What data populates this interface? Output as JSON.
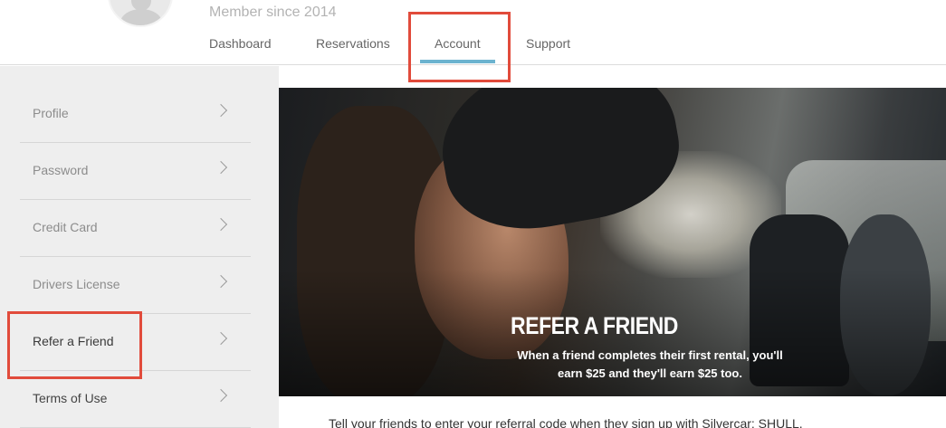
{
  "header": {
    "member_since": "Member since 2014",
    "tabs": [
      {
        "label": "Dashboard"
      },
      {
        "label": "Reservations"
      },
      {
        "label": "Account"
      },
      {
        "label": "Support"
      }
    ],
    "active_tab": "Account",
    "accent_color": "#6cb3cf",
    "highlight_color": "#e14b3b"
  },
  "sidebar": {
    "items": [
      {
        "label": "Profile"
      },
      {
        "label": "Password"
      },
      {
        "label": "Credit Card"
      },
      {
        "label": "Drivers License"
      },
      {
        "label": "Refer a Friend"
      },
      {
        "label": "Terms of Use"
      }
    ],
    "active_item": "Refer a Friend"
  },
  "hero": {
    "title": "REFER A FRIEND",
    "text": "When a friend completes their first rental, you'll earn $25 and they'll earn $25 too."
  },
  "main": {
    "referral_text": "Tell your friends to enter your referral code when they sign up with Silvercar: SHULL."
  }
}
